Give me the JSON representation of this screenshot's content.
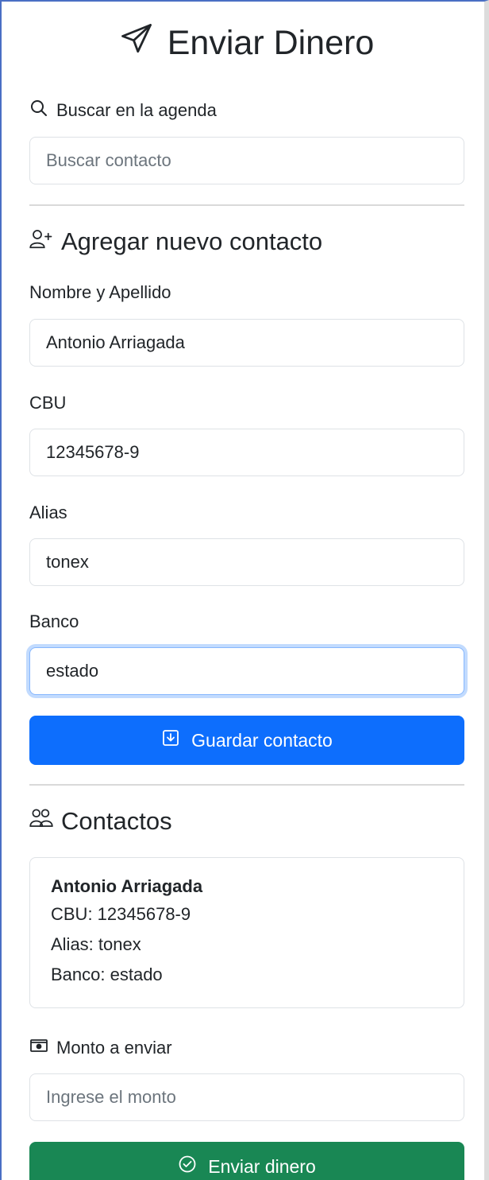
{
  "header": {
    "title": "Enviar Dinero",
    "icon": "send-icon"
  },
  "search": {
    "label": "Buscar en la agenda",
    "placeholder": "Buscar contacto",
    "value": ""
  },
  "new_contact": {
    "title": "Agregar nuevo contacto",
    "name_label": "Nombre y Apellido",
    "name_value": "Antonio Arriagada",
    "cbu_label": "CBU",
    "cbu_value": "12345678-9",
    "alias_label": "Alias",
    "alias_value": "tonex",
    "bank_label": "Banco",
    "bank_value": "estado",
    "save_label": "Guardar contacto"
  },
  "contacts": {
    "title": "Contactos",
    "items": [
      {
        "name": "Antonio Arriagada",
        "cbu": "CBU: 12345678-9",
        "alias": "Alias: tonex",
        "bank": "Banco: estado"
      }
    ]
  },
  "amount": {
    "label": "Monto a enviar",
    "placeholder": "Ingrese el monto",
    "value": "",
    "send_label": "Enviar dinero"
  },
  "colors": {
    "primary": "#0d6efd",
    "success": "#198754",
    "border": "#dee2e6",
    "text": "#212529",
    "placeholder": "#6c757d"
  }
}
